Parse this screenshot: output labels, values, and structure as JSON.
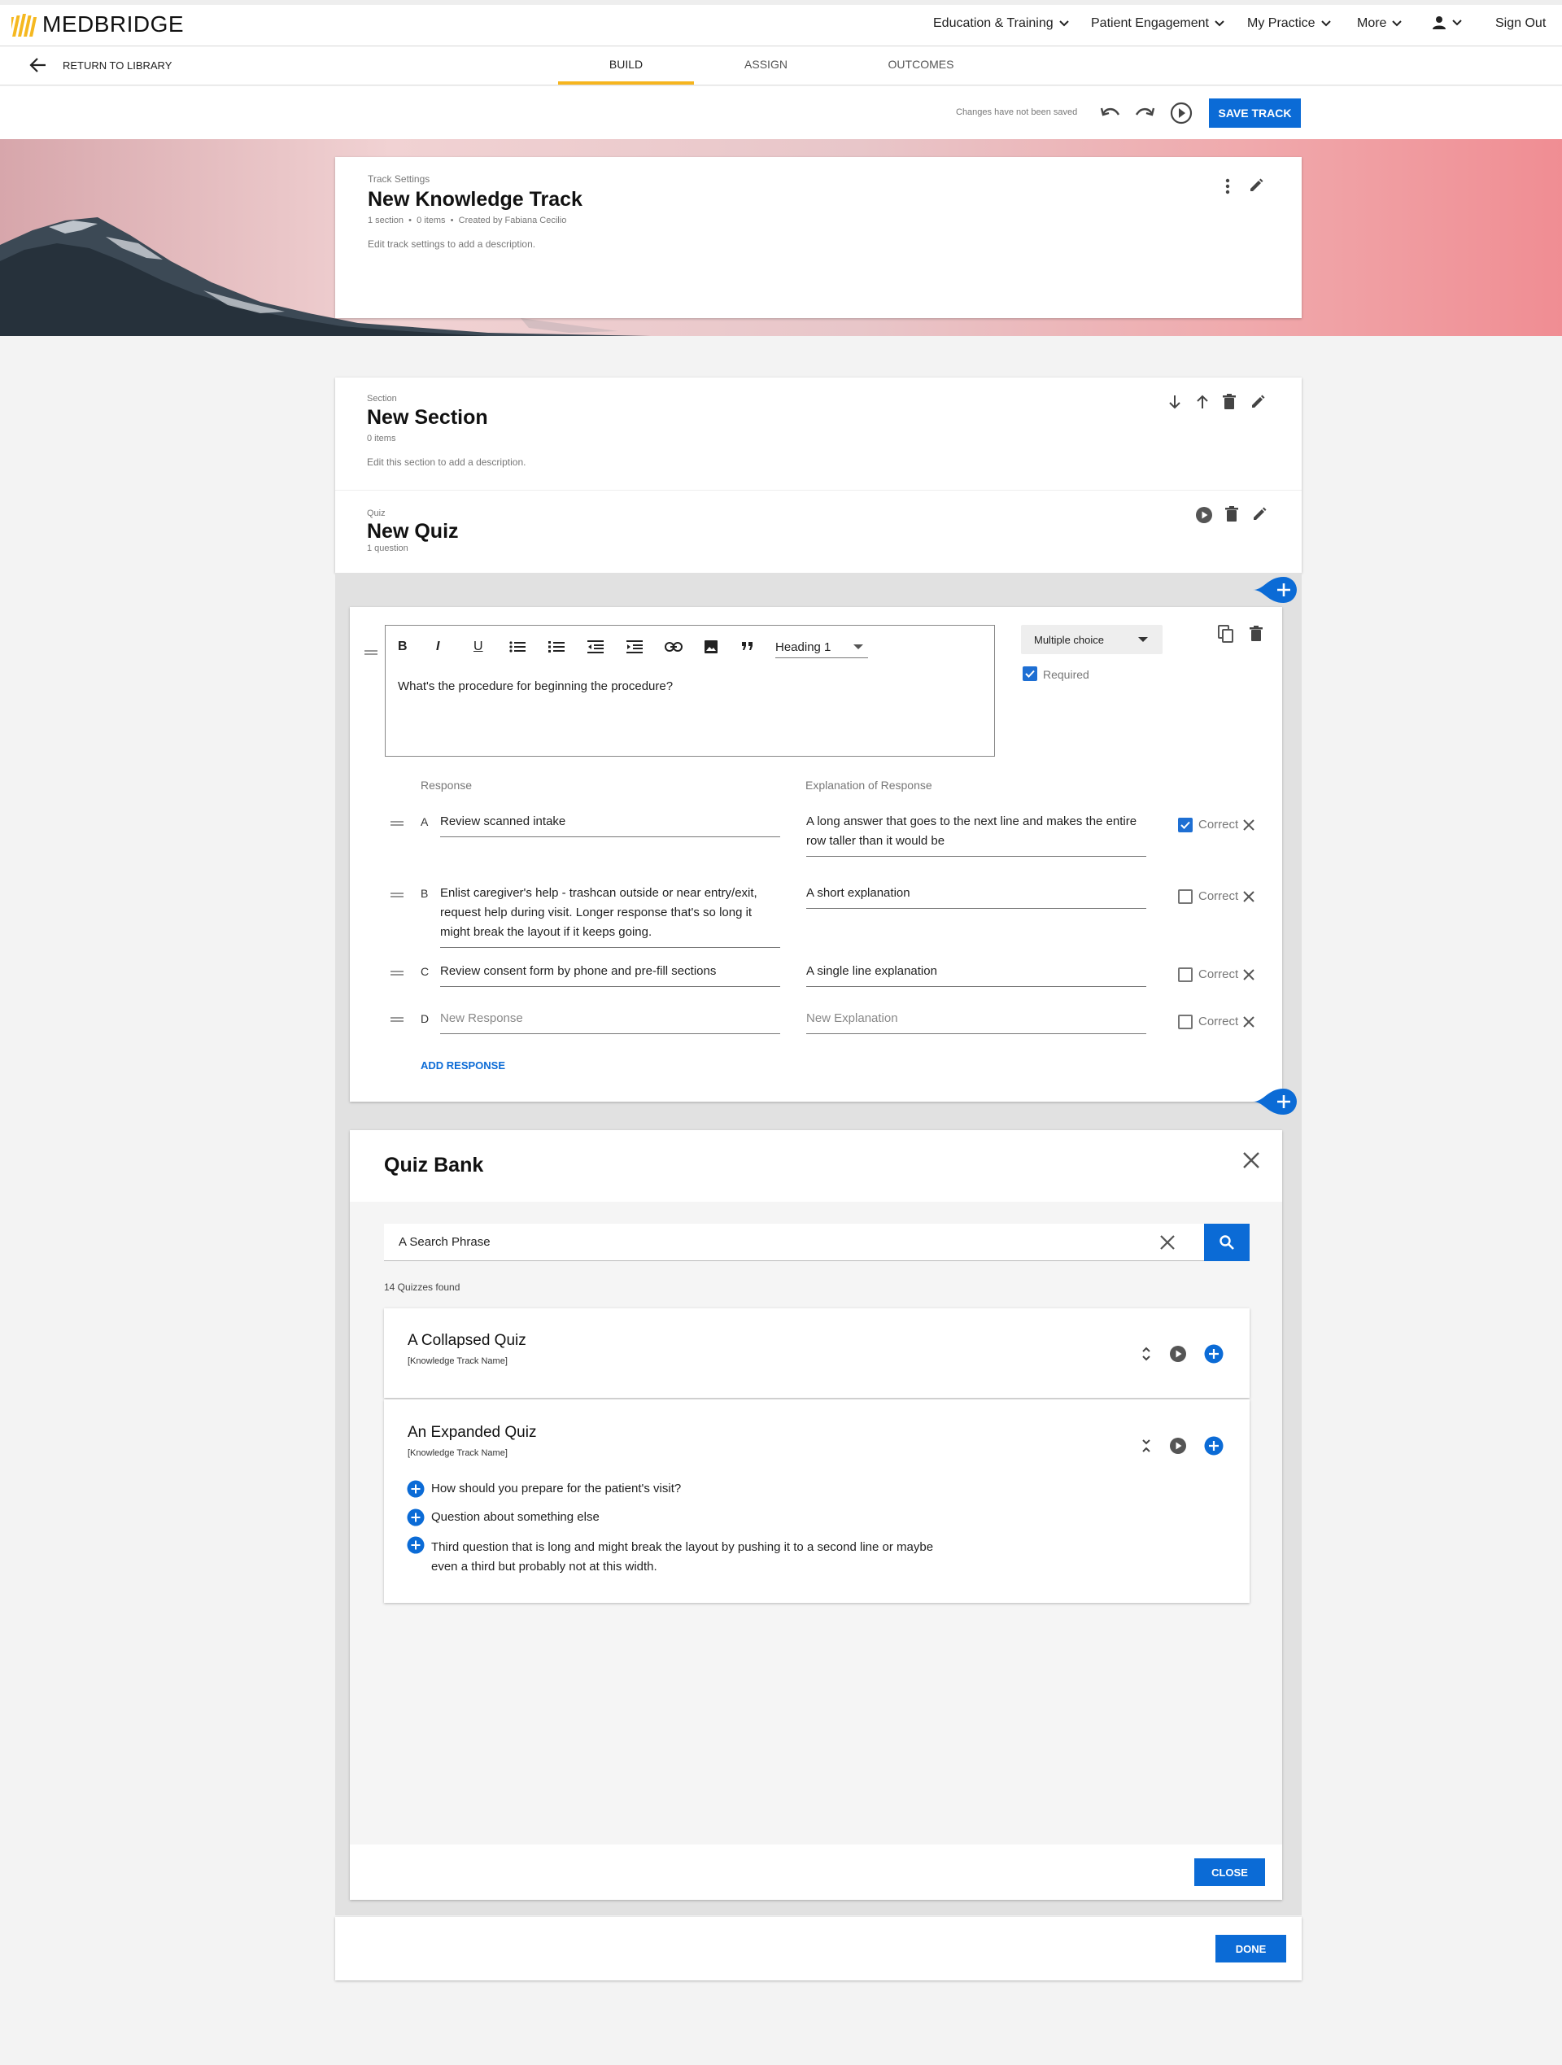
{
  "header": {
    "logo_text": "MEDBRIDGE",
    "nav": [
      {
        "label": "Education & Training"
      },
      {
        "label": "Patient Engagement"
      },
      {
        "label": "My Practice"
      },
      {
        "label": "More"
      }
    ],
    "sign_out": "Sign Out"
  },
  "subnav": {
    "back_label": "RETURN TO LIBRARY",
    "tabs": [
      {
        "label": "BUILD",
        "active": true
      },
      {
        "label": "ASSIGN",
        "active": false
      },
      {
        "label": "OUTCOMES",
        "active": false
      }
    ]
  },
  "toolbar": {
    "status": "Changes have not been saved",
    "save_label": "SAVE TRACK"
  },
  "track": {
    "kicker": "Track Settings",
    "title": "New Knowledge Track",
    "meta": "1 section  •  0 items  •  Created by Fabiana Cecilio",
    "description": "Edit track settings to add a description."
  },
  "section": {
    "kicker": "Section",
    "title": "New Section",
    "meta": "0 items",
    "description": "Edit this section to add a description."
  },
  "quiz": {
    "kicker": "Quiz",
    "title": "New Quiz",
    "meta": "1 question"
  },
  "question": {
    "heading_select": "Heading 1",
    "text": "What's the procedure for beginning the procedure?",
    "type": "Multiple choice",
    "required_label": "Required",
    "required": true,
    "response_header": "Response",
    "explanation_header": "Explanation of Response",
    "correct_label": "Correct",
    "responses": [
      {
        "letter": "A",
        "text": "Review scanned intake",
        "explanation": "A long answer that goes to the next line and makes the entire row taller than it would be",
        "correct": true
      },
      {
        "letter": "B",
        "text": "Enlist caregiver's help - trashcan outside or near entry/exit, request help during visit. Longer response that's so long it might break the layout if it keeps going.",
        "explanation": "A short explanation",
        "correct": false
      },
      {
        "letter": "C",
        "text": "Review consent form by phone and pre-fill sections",
        "explanation": "A single line explanation",
        "correct": false
      },
      {
        "letter": "D",
        "text": "",
        "explanation": "",
        "placeholder_response": "New Response",
        "placeholder_explanation": "New Explanation",
        "correct": false
      }
    ],
    "add_response": "ADD RESPONSE"
  },
  "quiz_bank": {
    "title": "Quiz Bank",
    "search_value": "A Search Phrase",
    "results_count": "14 Quizzes found",
    "results": [
      {
        "title": "A Collapsed Quiz",
        "subtitle": "[Knowledge Track Name]",
        "expanded": false
      },
      {
        "title": "An Expanded Quiz",
        "subtitle": "[Knowledge Track Name]",
        "expanded": true,
        "questions": [
          "How should you prepare for the patient's visit?",
          "Question about something else",
          "Third question that is long and might break the layout by pushing it to a second line or maybe even a third but probably not at this width."
        ]
      }
    ],
    "close_label": "CLOSE"
  },
  "done_label": "DONE",
  "colors": {
    "primary": "#0b6bd6",
    "tab_accent": "#f6b51e",
    "logo": "#f5b820"
  }
}
